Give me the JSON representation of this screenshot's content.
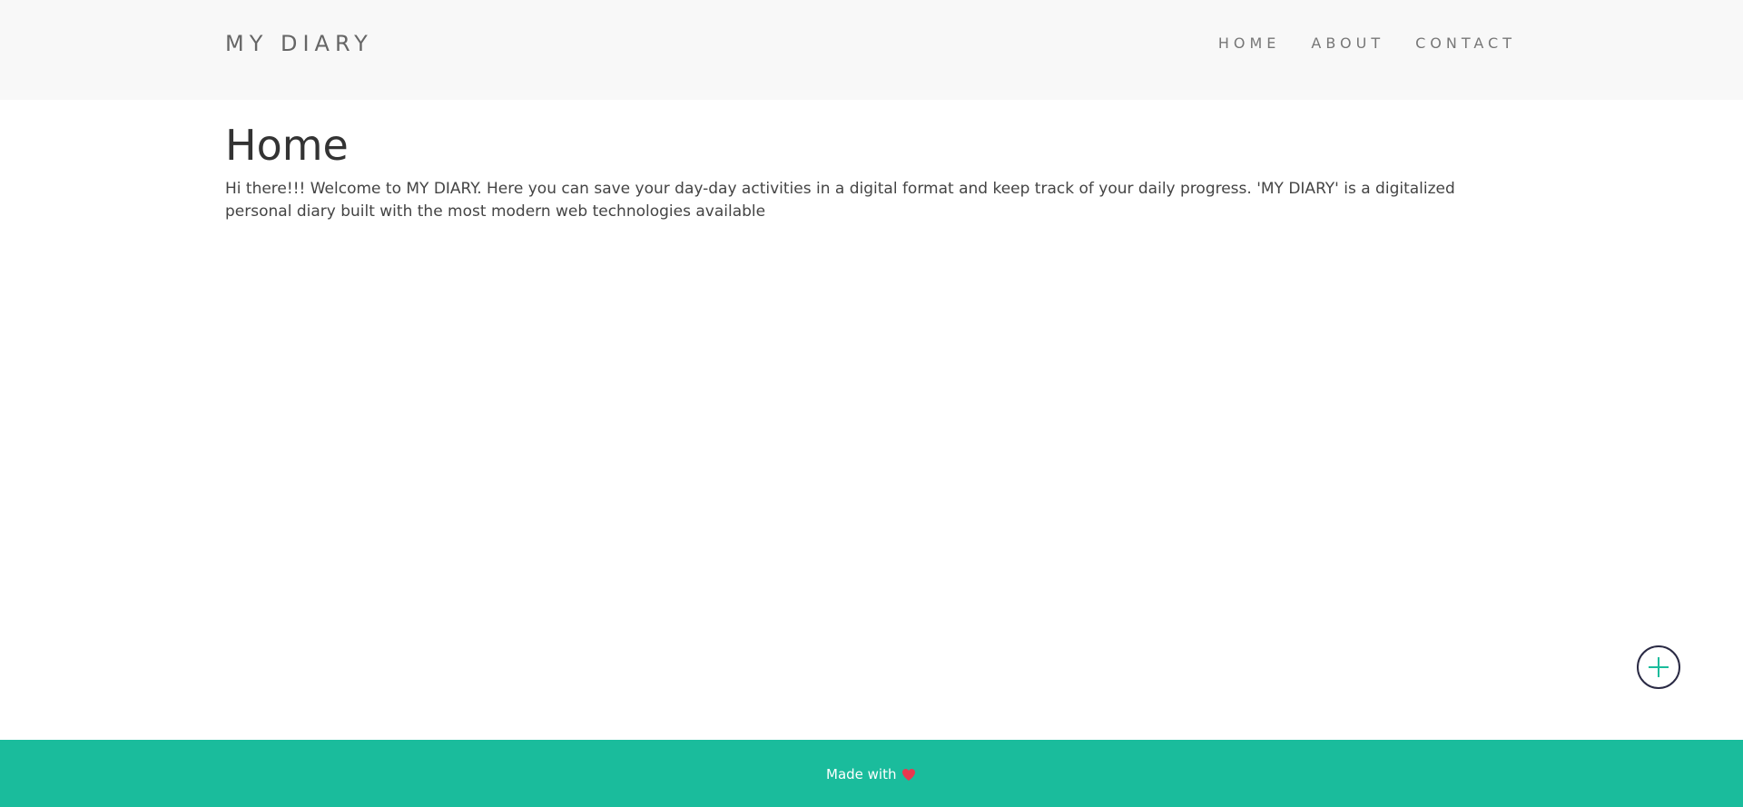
{
  "header": {
    "brand": "MY DIARY",
    "nav": [
      {
        "label": "HOME"
      },
      {
        "label": "ABOUT"
      },
      {
        "label": "CONTACT"
      }
    ]
  },
  "main": {
    "title": "Home",
    "intro": "Hi there!!! Welcome to MY DIARY. Here you can save your day-day activities in a digital format and keep track of your daily progress. 'MY DIARY' is a digitalized personal diary built with the most modern web technologies available"
  },
  "fab": {
    "icon": "plus-icon"
  },
  "footer": {
    "text": "Made with",
    "icon": "heart-icon"
  },
  "colors": {
    "header_bg": "#f8f8f8",
    "footer_bg": "#1abc9c",
    "accent": "#1abc9c",
    "heart": "#e8384f"
  }
}
